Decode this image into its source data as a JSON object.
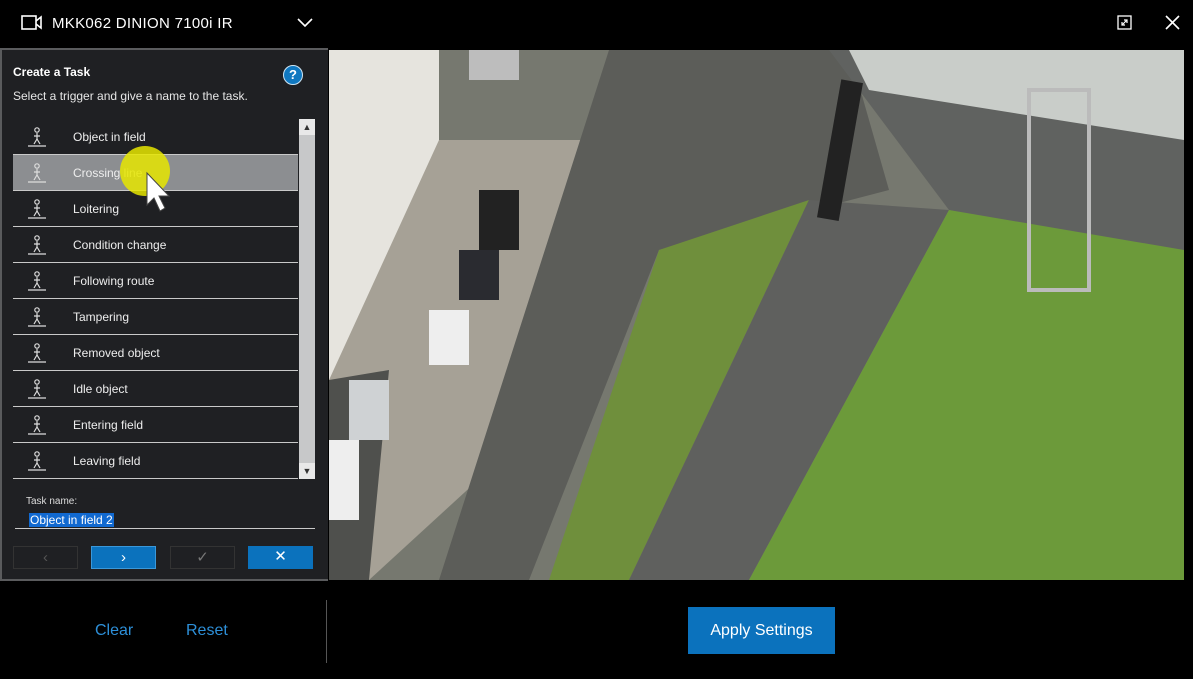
{
  "header": {
    "title": "MKK062 DINION 7100i IR"
  },
  "panel": {
    "title": "Create a Task",
    "subtitle": "Select a trigger and give a name to the task.",
    "help": "?",
    "triggers": [
      {
        "label": "Object in field",
        "icon": "object-in-field-icon"
      },
      {
        "label": "Crossing line",
        "icon": "crossing-line-icon",
        "selected": true
      },
      {
        "label": "Loitering",
        "icon": "loitering-icon"
      },
      {
        "label": "Condition change",
        "icon": "condition-change-icon"
      },
      {
        "label": "Following route",
        "icon": "following-route-icon"
      },
      {
        "label": "Tampering",
        "icon": "tampering-icon"
      },
      {
        "label": "Removed object",
        "icon": "removed-object-icon"
      },
      {
        "label": "Idle object",
        "icon": "idle-object-icon"
      },
      {
        "label": "Entering field",
        "icon": "entering-field-icon"
      },
      {
        "label": "Leaving field",
        "icon": "leaving-field-icon"
      }
    ],
    "task_name_label": "Task name:",
    "task_name_value": "Object in field 2"
  },
  "footer": {
    "clear": "Clear",
    "reset": "Reset",
    "apply": "Apply Settings"
  },
  "colors": {
    "accent": "#0b72bd",
    "link": "#2d8fd8"
  }
}
